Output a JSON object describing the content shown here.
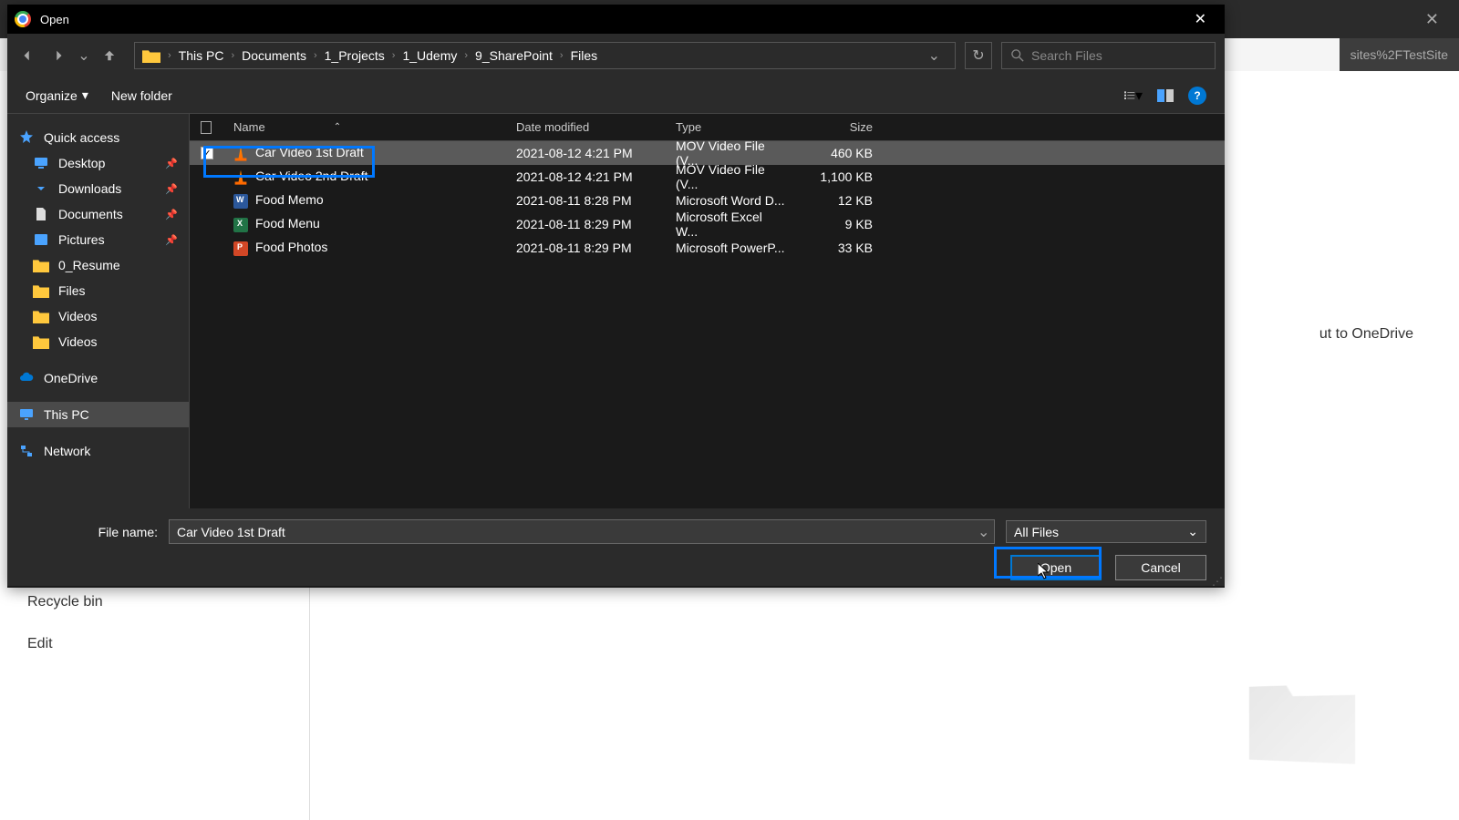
{
  "browser": {
    "url_fragment": "sites%2FTestSite",
    "onedrive_text": "ut to OneDrive",
    "sidebar": {
      "recycle": "Recycle bin",
      "edit": "Edit"
    }
  },
  "dialog": {
    "title": "Open",
    "search_placeholder": "Search Files",
    "toolbar": {
      "organize": "Organize",
      "new_folder": "New folder"
    },
    "breadcrumb": [
      "This PC",
      "Documents",
      "1_Projects",
      "1_Udemy",
      "9_SharePoint",
      "Files"
    ],
    "tree": {
      "quick_access": "Quick access",
      "pinned": [
        {
          "label": "Desktop",
          "icon": "desktop"
        },
        {
          "label": "Downloads",
          "icon": "download"
        },
        {
          "label": "Documents",
          "icon": "document"
        },
        {
          "label": "Pictures",
          "icon": "picture"
        }
      ],
      "folders": [
        {
          "label": "0_Resume"
        },
        {
          "label": "Files"
        },
        {
          "label": "Videos"
        },
        {
          "label": "Videos"
        }
      ],
      "onedrive": "OneDrive",
      "this_pc": "This PC",
      "network": "Network"
    },
    "columns": {
      "name": "Name",
      "date": "Date modified",
      "type": "Type",
      "size": "Size"
    },
    "files": [
      {
        "name": "Car Video 1st Draft",
        "date": "2021-08-12 4:21 PM",
        "type": "MOV Video File (V...",
        "size": "460 KB",
        "icon": "vlc",
        "selected": true,
        "checked": true
      },
      {
        "name": "Car Video 2nd Draft",
        "date": "2021-08-12 4:21 PM",
        "type": "MOV Video File (V...",
        "size": "1,100 KB",
        "icon": "vlc",
        "selected": false,
        "checked": false
      },
      {
        "name": "Food Memo",
        "date": "2021-08-11 8:28 PM",
        "type": "Microsoft Word D...",
        "size": "12 KB",
        "icon": "word",
        "selected": false,
        "checked": false
      },
      {
        "name": "Food Menu",
        "date": "2021-08-11 8:29 PM",
        "type": "Microsoft Excel W...",
        "size": "9 KB",
        "icon": "excel",
        "selected": false,
        "checked": false
      },
      {
        "name": "Food Photos",
        "date": "2021-08-11 8:29 PM",
        "type": "Microsoft PowerP...",
        "size": "33 KB",
        "icon": "ppt",
        "selected": false,
        "checked": false
      }
    ],
    "filename_label": "File name:",
    "filename_value": "Car Video 1st Draft",
    "filetype": "All Files",
    "buttons": {
      "open": "Open",
      "cancel": "Cancel"
    }
  }
}
